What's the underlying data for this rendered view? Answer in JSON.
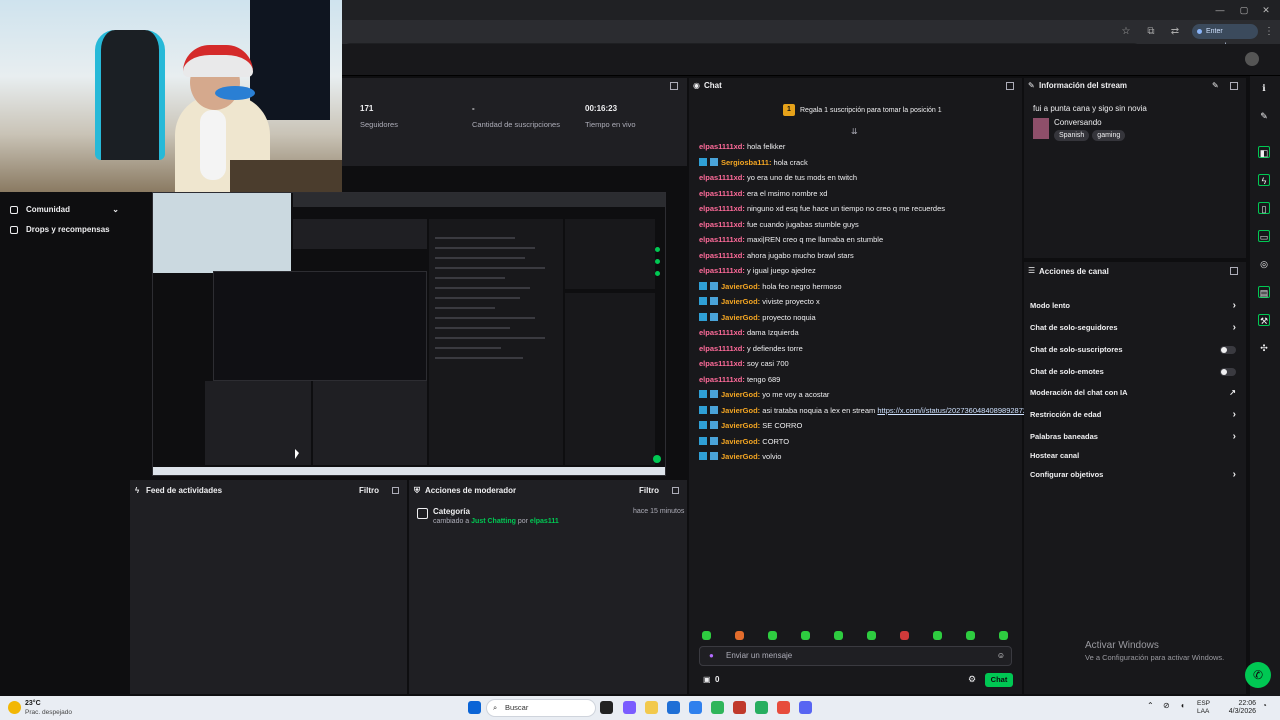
{
  "browser": {
    "passphrase_button": "Enter passphrase"
  },
  "stats": {
    "followers_value": "171",
    "followers_label": "Seguidores",
    "subs_value": "-",
    "subs_label": "Cantidad de suscripciones",
    "live_time_value": "00:16:23",
    "live_time_label": "Tiempo en vivo"
  },
  "sidebar": {
    "items": [
      {
        "label": "Comunidad"
      },
      {
        "label": "Drops y recompensas"
      }
    ]
  },
  "activity_feed": {
    "title": "Feed de actividades",
    "filter": "Filtro"
  },
  "mod_actions": {
    "title": "Acciones de moderador",
    "filter": "Filtro",
    "entry": {
      "title": "Categoría",
      "time": "hace 15 minutos",
      "prefix": "cambiado a",
      "category": "Just Chatting",
      "by": "por",
      "user": "elpas111"
    }
  },
  "chat": {
    "title": "Chat",
    "gift_banner": "Regala 1 suscripción para tomar la posición 1",
    "gift_rank": "1",
    "input_placeholder": "Enviar un mensaje",
    "points": "0",
    "send_label": "Chat",
    "messages": [
      {
        "user": "elpas1111xd:",
        "text": "hola felkker",
        "color": "pink",
        "badge": false
      },
      {
        "user": "Sergiosba111:",
        "text": "hola crack",
        "color": "orange",
        "badge": true
      },
      {
        "user": "elpas1111xd:",
        "text": "yo era uno de tus mods en twitch",
        "color": "pink",
        "badge": false
      },
      {
        "user": "elpas1111xd:",
        "text": "era el msimo nombre xd",
        "color": "pink",
        "badge": false
      },
      {
        "user": "elpas1111xd:",
        "text": "ninguno xd esq fue hace un tiempo no creo q me recuerdes",
        "color": "pink",
        "badge": false
      },
      {
        "user": "elpas1111xd:",
        "text": "fue cuando jugabas stumble guys",
        "color": "pink",
        "badge": false
      },
      {
        "user": "elpas1111xd:",
        "text": "maxi|REN creo q me llamaba en stumble",
        "color": "pink",
        "badge": false
      },
      {
        "user": "elpas1111xd:",
        "text": "ahora jugabo mucho brawl stars",
        "color": "pink",
        "badge": false
      },
      {
        "user": "elpas1111xd:",
        "text": "y igual juego ajedrez",
        "color": "pink",
        "badge": false
      },
      {
        "user": "JavierGod:",
        "text": "hola feo negro hermoso",
        "color": "orange",
        "badge": true
      },
      {
        "user": "JavierGod:",
        "text": "viviste proyecto x",
        "color": "orange",
        "badge": true
      },
      {
        "user": "JavierGod:",
        "text": "proyecto noquia",
        "color": "orange",
        "badge": true
      },
      {
        "user": "elpas1111xd:",
        "text": "dama Izquierda",
        "color": "pink",
        "badge": false
      },
      {
        "user": "elpas1111xd:",
        "text": "y defiendes torre",
        "color": "pink",
        "badge": false
      },
      {
        "user": "elpas1111xd:",
        "text": "soy casi 700",
        "color": "pink",
        "badge": false
      },
      {
        "user": "elpas1111xd:",
        "text": "tengo 689",
        "color": "pink",
        "badge": false
      },
      {
        "user": "JavierGod:",
        "text": "yo me voy a acostar",
        "color": "orange",
        "badge": true
      },
      {
        "user": "JavierGod:",
        "text": "asi trataba noquia a lex en stream",
        "link": "https://x.com/i/status/2027360484089892872",
        "color": "orange",
        "badge": true
      },
      {
        "user": "JavierGod:",
        "text": "SE CORRO",
        "color": "orange",
        "badge": true
      },
      {
        "user": "JavierGod:",
        "text": "CORTO",
        "color": "orange",
        "badge": true
      },
      {
        "user": "JavierGod:",
        "text": "volvio",
        "color": "orange",
        "badge": true
      }
    ]
  },
  "stream_info": {
    "title": "Información del stream",
    "stream_title": "fui a punta cana y sigo sin novia",
    "category": "Conversando",
    "tags": [
      "Spanish",
      "gaming"
    ]
  },
  "channel_actions": {
    "title": "Acciones de canal",
    "items": [
      {
        "label": "Modo lento",
        "control": "chevron"
      },
      {
        "label": "Chat de solo-seguidores",
        "control": "chevron"
      },
      {
        "label": "Chat de solo-suscriptores",
        "control": "toggle"
      },
      {
        "label": "Chat de solo-emotes",
        "control": "toggle"
      },
      {
        "label": "Moderación del chat con IA",
        "control": "external"
      },
      {
        "label": "Restricción de edad",
        "control": "chevron"
      },
      {
        "label": "Palabras baneadas",
        "control": "chevron"
      },
      {
        "label": "Hostear canal",
        "control": "none"
      },
      {
        "label": "Configurar objetivos",
        "control": "chevron"
      }
    ]
  },
  "watermark": {
    "line1": "Activar Windows",
    "line2": "Ve a Configuración para activar Windows."
  },
  "taskbar": {
    "weather_temp": "23°C",
    "weather_desc": "Prac. despejado",
    "search_label": "Buscar",
    "lang": "ESP",
    "lang_sub": "LAA",
    "time": "22:06",
    "date": "4/3/2026"
  },
  "colors": {
    "accent": "#00c853",
    "chat_user_pink": "#ff6b9a",
    "chat_user_orange": "#f4a623"
  }
}
